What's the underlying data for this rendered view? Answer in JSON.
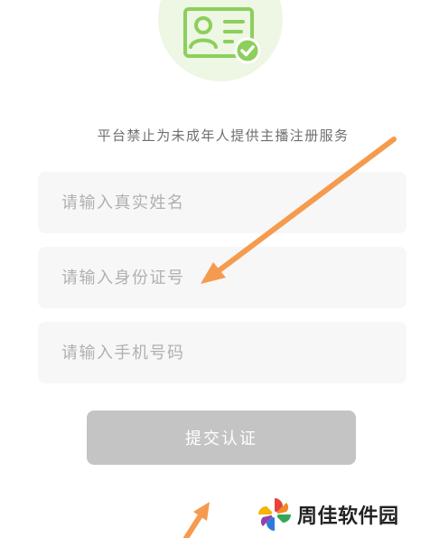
{
  "notice": "平台禁止为未成年人提供主播注册服务",
  "form": {
    "name_placeholder": "请输入真实姓名",
    "id_placeholder": "请输入身份证号",
    "phone_placeholder": "请输入手机号码"
  },
  "submit_label": "提交认证",
  "icon": {
    "name": "id-card-verified-icon",
    "color": "#8ccf5c",
    "circle_color": "#eef6e4"
  },
  "annotation": {
    "arrow_color": "#f59a4e"
  },
  "watermark": {
    "text": "周佳软件园",
    "logo": "pinwheel-logo"
  }
}
